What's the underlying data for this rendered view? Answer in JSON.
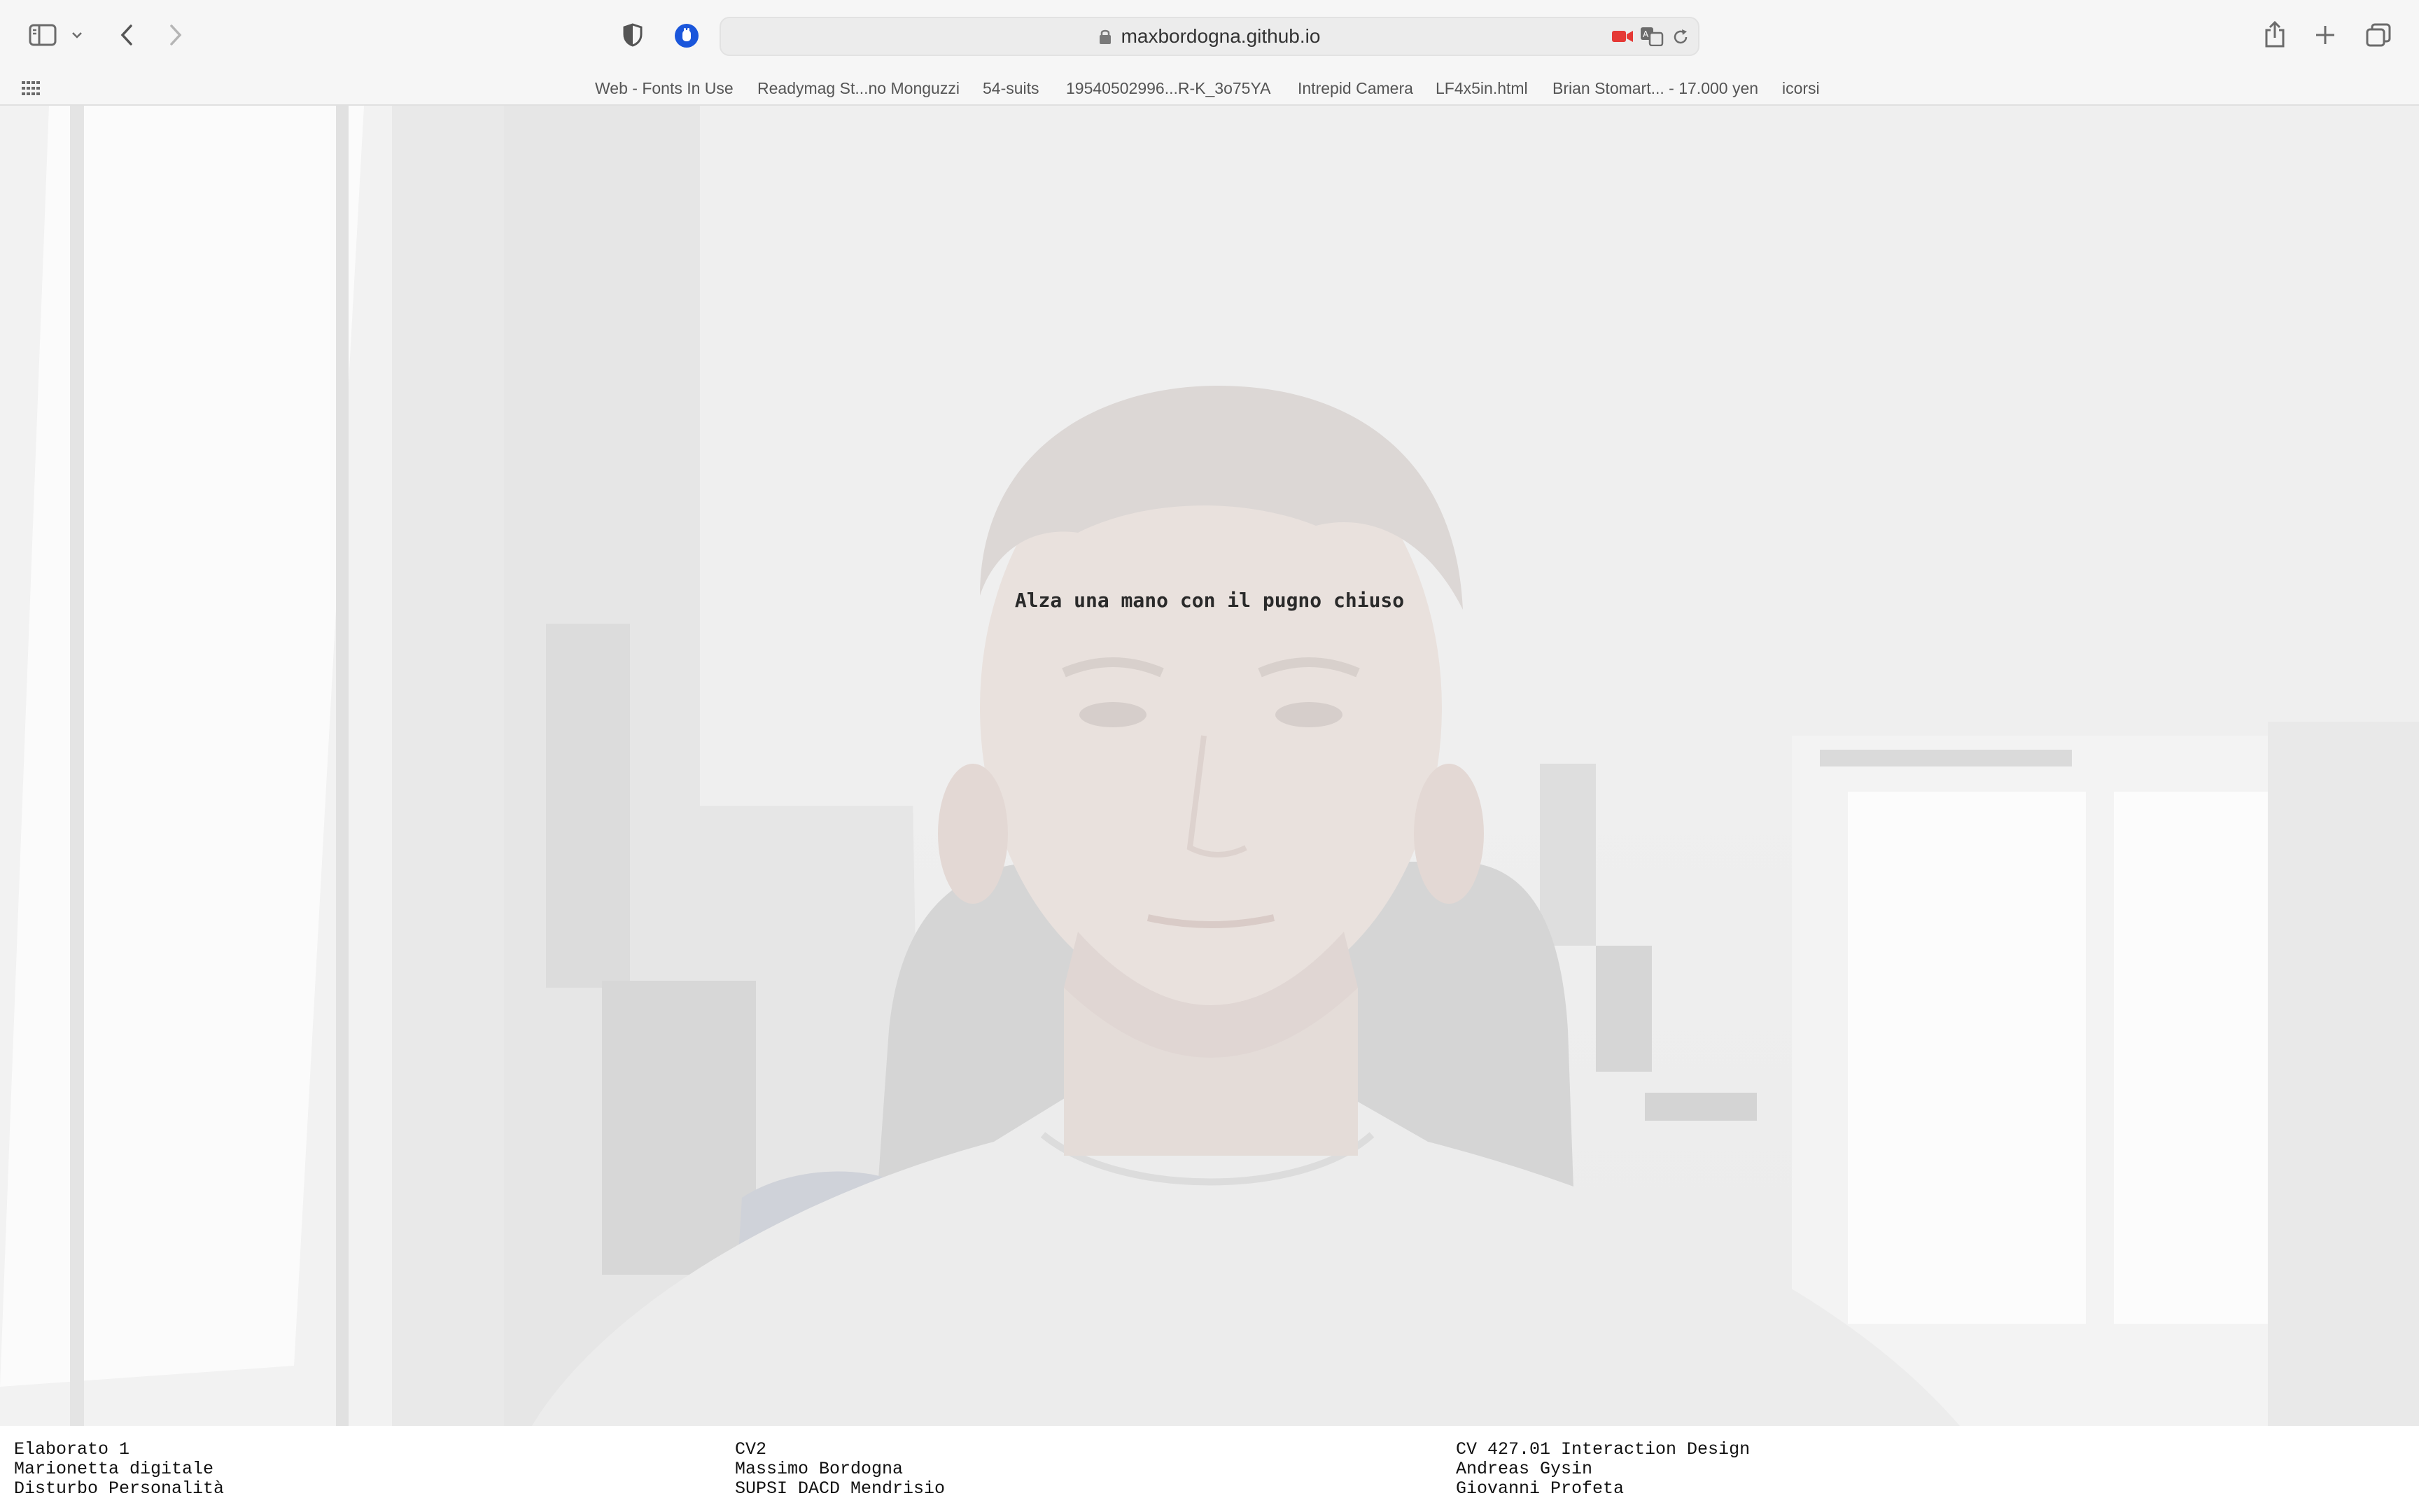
{
  "browser": {
    "url": "maxbordogna.github.io",
    "bookmarks": [
      "Web - Fonts In Use",
      "Readymag St...no Monguzzi",
      "54-suits",
      "19540502996...R-K_3o75YA",
      "Intrepid Camera",
      "LF4x5in.html",
      "Brian Stomart... - 17.000 yen",
      "icorsi"
    ],
    "icons": {
      "sidebar": "sidebar-icon",
      "back": "chevron-left-icon",
      "forward": "chevron-right-icon",
      "privacy": "shield-icon",
      "extension": "hand-icon",
      "camera": "camera-icon",
      "translate": "translate-icon",
      "reload": "reload-icon",
      "share": "share-icon",
      "new_tab": "plus-icon",
      "tabs": "tab-overview-icon",
      "grid": "grid-icon"
    },
    "colors": {
      "camera_indicator": "#e53935",
      "extension_blue": "#1a56db"
    }
  },
  "page": {
    "prompt": "Alza una mano con il pugno chiuso",
    "credits": [
      [
        "Elaborato 1",
        "Marionetta digitale",
        "Disturbo Personalità"
      ],
      [
        "CV2",
        "Massimo Bordogna",
        "SUPSI DACD Mendrisio"
      ],
      [
        "CV 427.01 Interaction Design",
        "Andreas Gysin",
        "Giovanni Profeta"
      ]
    ]
  }
}
